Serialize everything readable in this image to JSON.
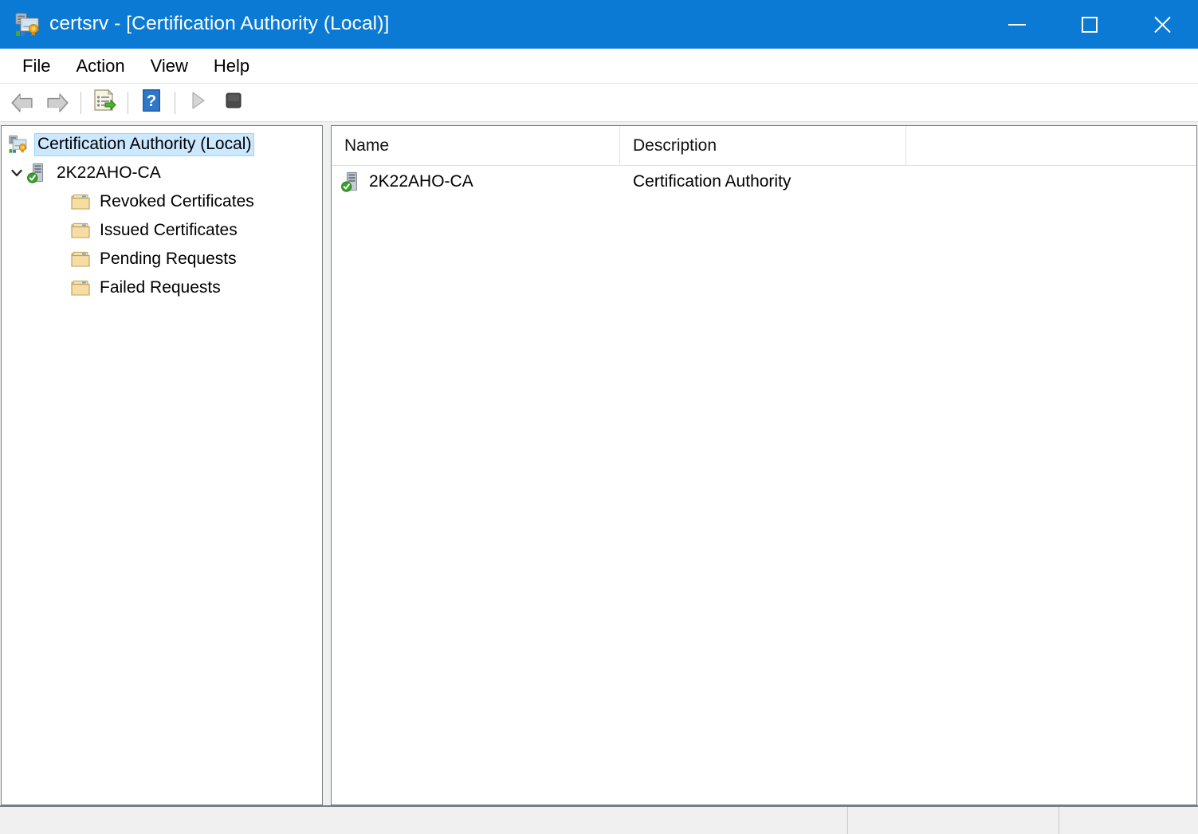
{
  "window": {
    "title": "certsrv - [Certification Authority (Local)]",
    "icon": "certification-authority-icon",
    "titlebar_color": "#0b7ad5",
    "controls": {
      "minimize": "Minimize",
      "maximize": "Maximize",
      "close": "Close"
    }
  },
  "menubar": {
    "items": [
      {
        "label": "File"
      },
      {
        "label": "Action"
      },
      {
        "label": "View"
      },
      {
        "label": "Help"
      }
    ]
  },
  "toolbar": {
    "buttons": [
      {
        "name": "back-button",
        "icon": "back-arrow-icon",
        "enabled": false
      },
      {
        "name": "forward-button",
        "icon": "forward-arrow-icon",
        "enabled": false
      },
      {
        "name": "export-list-button",
        "icon": "export-list-icon",
        "enabled": true
      },
      {
        "name": "help-button",
        "icon": "help-question-icon",
        "enabled": true
      },
      {
        "name": "start-service-button",
        "icon": "play-triangle-icon",
        "enabled": false
      },
      {
        "name": "stop-service-button",
        "icon": "stop-square-icon",
        "enabled": true
      }
    ]
  },
  "tree": {
    "selection_color": "#cce8ff",
    "nodes": [
      {
        "label": "Certification Authority (Local)",
        "icon": "certification-authority-icon",
        "depth": 0,
        "selected": true,
        "expandable": false,
        "expanded": false
      },
      {
        "label": "2K22AHO-CA",
        "icon": "ca-server-online-icon",
        "depth": 1,
        "selected": false,
        "expandable": true,
        "expanded": true
      },
      {
        "label": "Revoked Certificates",
        "icon": "folder-icon",
        "depth": 2,
        "selected": false,
        "expandable": false,
        "expanded": false
      },
      {
        "label": "Issued Certificates",
        "icon": "folder-icon",
        "depth": 2,
        "selected": false,
        "expandable": false,
        "expanded": false
      },
      {
        "label": "Pending Requests",
        "icon": "folder-icon",
        "depth": 2,
        "selected": false,
        "expandable": false,
        "expanded": false
      },
      {
        "label": "Failed Requests",
        "icon": "folder-icon",
        "depth": 2,
        "selected": false,
        "expandable": false,
        "expanded": false
      }
    ]
  },
  "listview": {
    "columns": [
      {
        "label": "Name"
      },
      {
        "label": "Description"
      },
      {
        "label": ""
      }
    ],
    "rows": [
      {
        "icon": "ca-server-online-icon",
        "name": "2K22AHO-CA",
        "description": "Certification Authority"
      }
    ]
  },
  "statusbar": {
    "main": "",
    "segment1": "",
    "segment2": ""
  }
}
